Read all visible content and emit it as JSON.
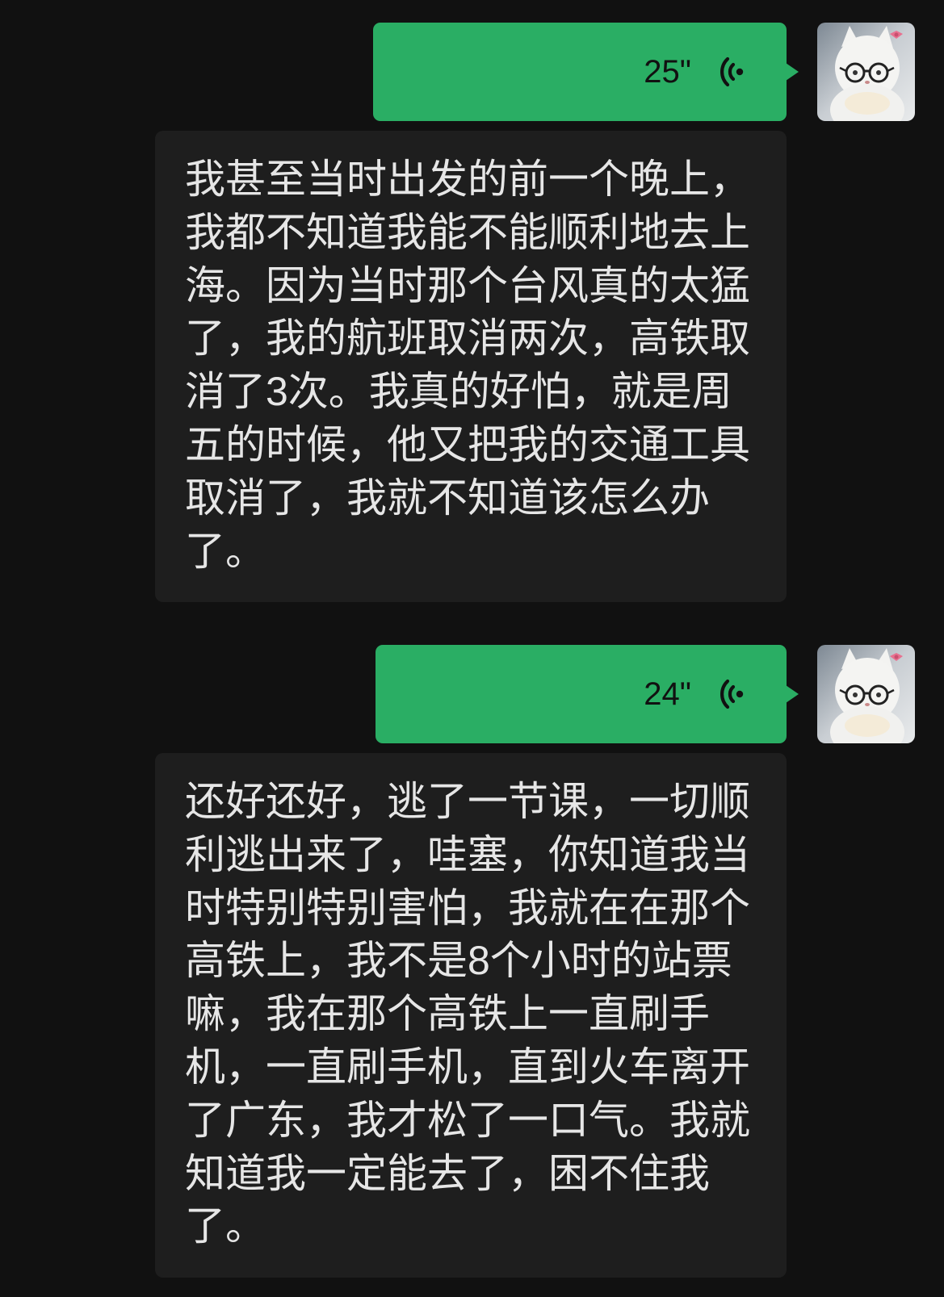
{
  "colors": {
    "background": "#111111",
    "voice_bubble": "#2aae64",
    "transcript_bubble": "#1e1e1e",
    "transcript_text": "#e6e6e6",
    "bow_pink": "#e8708f"
  },
  "messages": [
    {
      "type": "voice",
      "sender": "self",
      "duration": "25\"",
      "icon": "voice-playback-icon",
      "avatar": "white-cat-with-glasses"
    },
    {
      "type": "transcription",
      "lines": [
        "我甚至当时出发的前一个晚上，",
        "我都不知道我能不能顺利地去上",
        "海。因为当时那个台风真的太猛",
        "了，我的航班取消两次，高铁取",
        "消了3次。我真的好怕，就是周",
        "五的时候，他又把我的交通工具",
        "取消了，我就不知道该怎么办",
        "了。"
      ]
    },
    {
      "type": "voice",
      "sender": "self",
      "duration": "24\"",
      "icon": "voice-playback-icon",
      "avatar": "white-cat-with-glasses"
    },
    {
      "type": "transcription",
      "lines": [
        "还好还好，逃了一节课，一切顺",
        "利逃出来了，哇塞，你知道我当",
        "时特别特别害怕，我就在在那个",
        "高铁上，我不是8个小时的站票",
        "嘛，我在那个高铁上一直刷手",
        "机，一直刷手机，直到火车离开",
        "了广东，我才松了一口气。我就",
        "知道我一定能去了，困不住我",
        "了。"
      ]
    }
  ]
}
